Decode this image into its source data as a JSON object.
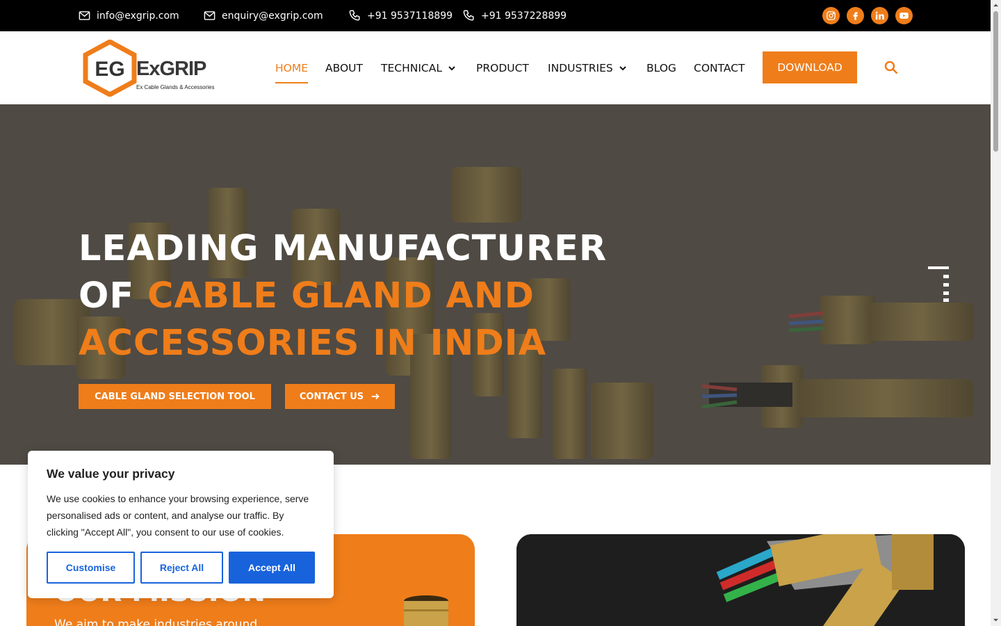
{
  "topbar": {
    "email_1": "info@exgrip.com",
    "email_2": "enquiry@exgrip.com",
    "phone_1": "+91 9537118899",
    "phone_2": "+91 9537228899",
    "social": [
      "instagram-icon",
      "facebook-icon",
      "linkedin-icon",
      "youtube-icon"
    ]
  },
  "brand": {
    "name": "ExGRIP",
    "tagline": "Ex Cable Glands & Accessories",
    "monogram": "EG"
  },
  "nav": {
    "items": [
      {
        "label": "HOME",
        "active": true
      },
      {
        "label": "ABOUT"
      },
      {
        "label": "TECHNICAL",
        "dropdown": true
      },
      {
        "label": "PRODUCT"
      },
      {
        "label": "INDUSTRIES",
        "dropdown": true
      },
      {
        "label": "BLOG"
      },
      {
        "label": "CONTACT"
      }
    ],
    "download_label": "DOWNLOAD"
  },
  "hero": {
    "title_line1": "LEADING MANUFACTURER",
    "title_of": "OF ",
    "title_highlight_1": "CABLE GLAND AND",
    "title_highlight_2": "ACCESSORIES IN INDIA",
    "button_1": "CABLE GLAND SELECTION TOOL",
    "button_2": "CONTACT US"
  },
  "mission": {
    "title": "OUR MISSION",
    "text": "We aim to make industries around"
  },
  "cookie": {
    "title": "We value your privacy",
    "text": "We use cookies to enhance your browsing experience, serve personalised ads or content, and analyse our traffic. By clicking \"Accept All\", you consent to our use of cookies.",
    "customise": "Customise",
    "reject": "Reject All",
    "accept": "Accept All"
  },
  "colors": {
    "accent": "#ef7d1a",
    "cookie_primary": "#1863dc",
    "topbar_bg": "#000000"
  }
}
